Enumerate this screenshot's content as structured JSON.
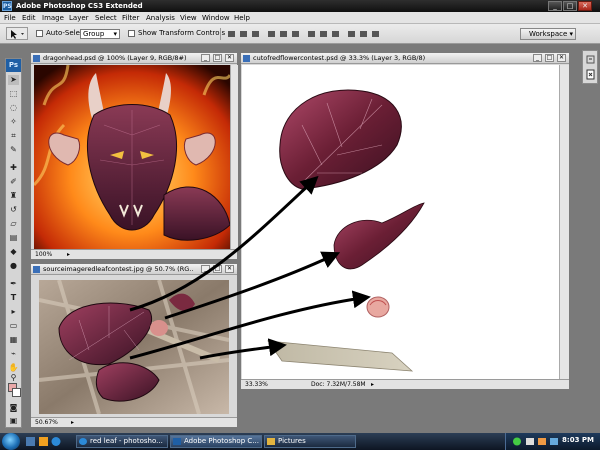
{
  "window": {
    "app_icon": "PS",
    "title": "Adobe Photoshop CS3 Extended",
    "min": "_",
    "max": "□",
    "close": "✕"
  },
  "menu": [
    "File",
    "Edit",
    "Image",
    "Layer",
    "Select",
    "Filter",
    "Analysis",
    "View",
    "Window",
    "Help"
  ],
  "options": {
    "auto_select_label": "Auto-Select:",
    "auto_select_value": "Group",
    "transform_label": "Show Transform Controls",
    "workspace_label": "Workspace ▾"
  },
  "toolbox": {
    "logo": "Ps"
  },
  "documents": {
    "dragon": {
      "title": "dragonhead.psd @ 100% (Layer 9, RGB/8#)",
      "zoom": "100%"
    },
    "source": {
      "title": "sourceimageredleafcontest.jpg @ 50.7% (RG...",
      "zoom": "50.67%"
    },
    "cutout": {
      "title": "cutofredflowercontest.psd @ 33.3% (Layer 3, RGB/8)",
      "zoom": "33.33%",
      "doc_info": "Doc: 7.32M/7.58M"
    }
  },
  "taskbar": {
    "items": [
      {
        "label": "red leaf - photosho..."
      },
      {
        "label": "Adobe Photoshop C..."
      },
      {
        "label": "Pictures"
      }
    ],
    "clock": "8:03 PM"
  },
  "colors": {
    "accent": "#1f5fa5",
    "foreground_swatch": "#e8a8a8"
  }
}
